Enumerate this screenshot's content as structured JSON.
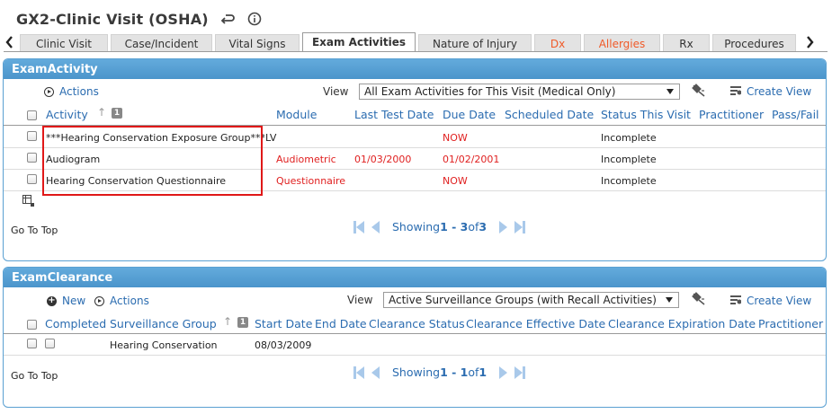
{
  "header": {
    "title": "GX2-Clinic Visit (OSHA)",
    "undo_icon": "undo-arrow-icon",
    "info_icon": "info-icon"
  },
  "tabs": [
    {
      "label": "Clinic Visit",
      "active": false,
      "color": "#333333"
    },
    {
      "label": "Case/Incident",
      "active": false,
      "color": "#333333"
    },
    {
      "label": "Vital Signs",
      "active": false,
      "color": "#333333"
    },
    {
      "label": "Exam Activities",
      "active": true,
      "color": "#333333"
    },
    {
      "label": "Nature of Injury",
      "active": false,
      "color": "#333333"
    },
    {
      "label": "Dx",
      "active": false,
      "color": "#f05a28"
    },
    {
      "label": "Allergies",
      "active": false,
      "color": "#f05a28"
    },
    {
      "label": "Rx",
      "active": false,
      "color": "#333333"
    },
    {
      "label": "Procedures",
      "active": false,
      "color": "#333333"
    }
  ],
  "exam_activity": {
    "title": "ExamActivity",
    "actions_label": "Actions",
    "view_label": "View",
    "view_selected": "All Exam Activities for This Visit (Medical Only)",
    "create_view_label": "Create View",
    "columns": [
      "Activity",
      "Module",
      "Last Test Date",
      "Due Date",
      "Scheduled Date",
      "Status This Visit",
      "Practitioner",
      "Pass/Fail"
    ],
    "sort_badge": "1",
    "rows": [
      {
        "activity": "***Hearing Conservation Exposure Group***LV",
        "module": "",
        "last_test_date": "",
        "due_date": "NOW",
        "status": "Incomplete"
      },
      {
        "activity": "Audiogram",
        "module": "Audiometric",
        "last_test_date": "01/03/2000",
        "due_date": "01/02/2001",
        "status": "Incomplete"
      },
      {
        "activity": "Hearing Conservation Questionnaire",
        "module": "Questionnaire",
        "last_test_date": "",
        "due_date": "NOW",
        "status": "Incomplete"
      }
    ],
    "go_to_top": "Go To Top",
    "pager": {
      "prefix": "Showing ",
      "range": "1 - 3",
      "of": " of ",
      "total": "3"
    }
  },
  "exam_clearance": {
    "title": "ExamClearance",
    "new_label": "New",
    "actions_label": "Actions",
    "view_label": "View",
    "view_selected": "Active Surveillance Groups (with Recall Activities)",
    "create_view_label": "Create View",
    "columns": [
      "Completed",
      "Surveillance Group",
      "Start Date",
      "End Date",
      "Clearance Status",
      "Clearance Effective Date",
      "Clearance Expiration Date",
      "Practitioner"
    ],
    "sort_badge": "1",
    "rows": [
      {
        "surveillance_group": "Hearing Conservation",
        "start_date": "08/03/2009"
      }
    ],
    "go_to_top": "Go To Top",
    "pager": {
      "prefix": "Showing ",
      "range": "1 - 1",
      "of": " of ",
      "total": "1"
    }
  },
  "colors": {
    "panel_header": "#4b95cb",
    "link": "#2b6cb0",
    "due_red": "#e02020",
    "tab_red": "#f05a28",
    "highlight_box": "#e01818"
  }
}
